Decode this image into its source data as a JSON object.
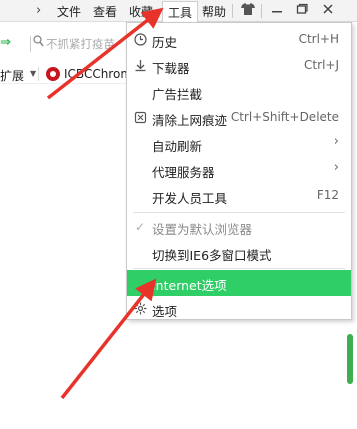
{
  "menubar": {
    "items": [
      "文件",
      "查看",
      "收藏",
      "工具",
      "帮助"
    ],
    "active_index": 3,
    "window_controls": [
      "shirt-icon",
      "minimize-icon",
      "restore-icon",
      "close-icon"
    ]
  },
  "address_bar": {
    "placeholder": "不抓紧打疫苗"
  },
  "favorites_bar": {
    "extensions_label": "扩展",
    "bookmark_label": "ICBCChrom"
  },
  "tools_menu": {
    "items": [
      {
        "label": "历史",
        "shortcut": "Ctrl+H",
        "icon": "clock-icon"
      },
      {
        "label": "下载器",
        "shortcut": "Ctrl+J",
        "icon": "download-icon"
      },
      {
        "label": "广告拦截",
        "shortcut": "",
        "icon": ""
      },
      {
        "label": "清除上网痕迹",
        "shortcut": "Ctrl+Shift+Delete",
        "icon": "broom-icon"
      },
      {
        "label": "自动刷新",
        "submenu": true
      },
      {
        "label": "代理服务器",
        "submenu": true
      },
      {
        "label": "开发人员工具",
        "shortcut": "F12"
      },
      {
        "label": "设置为默认浏览器",
        "disabled": true,
        "icon": "check-icon"
      },
      {
        "label": "切换到IE6多窗口模式"
      },
      {
        "label": "Internet选项",
        "highlighted": true
      },
      {
        "label": "选项",
        "icon": "gear-icon"
      }
    ]
  },
  "colors": {
    "highlight": "#2fce67",
    "arrow": "#e8332a",
    "scroll_thumb": "#3fae4e"
  }
}
